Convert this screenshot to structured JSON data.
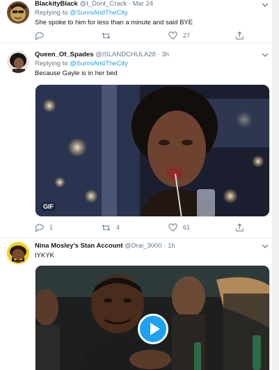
{
  "tweets": [
    {
      "name": "BlackityBlack",
      "handle": "@I_Dont_Crack",
      "separator": "·",
      "time": "Mar 24",
      "replying_prefix": "Replying to",
      "replying_to": "@SunniAndTheCity",
      "text": "She spoke to him for less than a minute and said BYE",
      "reply_count": "",
      "retweet_count": "",
      "like_count": "27"
    },
    {
      "name": "Queen_Of_Spades",
      "handle": "@ISLANDCHULA28",
      "separator": "·",
      "time": "3h",
      "replying_prefix": "Replying to",
      "replying_to": "@SunniAndTheCity",
      "text": "Because Gayle is in her bed",
      "media_badge": "GIF",
      "reply_count": "1",
      "retweet_count": "4",
      "like_count": "61"
    },
    {
      "name": "Nina Mosley's Stan Account",
      "handle": "@Drai_3000",
      "separator": "·",
      "time": "1h",
      "text": "IYKYK"
    }
  ],
  "icons": {
    "reply": "reply-icon",
    "retweet": "retweet-icon",
    "like": "heart-icon",
    "share": "share-icon",
    "more": "chevron-down-icon",
    "play": "play-icon"
  },
  "colors": {
    "accent": "#1da1f2",
    "muted": "#657786",
    "text": "#14171a",
    "divider": "#e6ecf0"
  }
}
